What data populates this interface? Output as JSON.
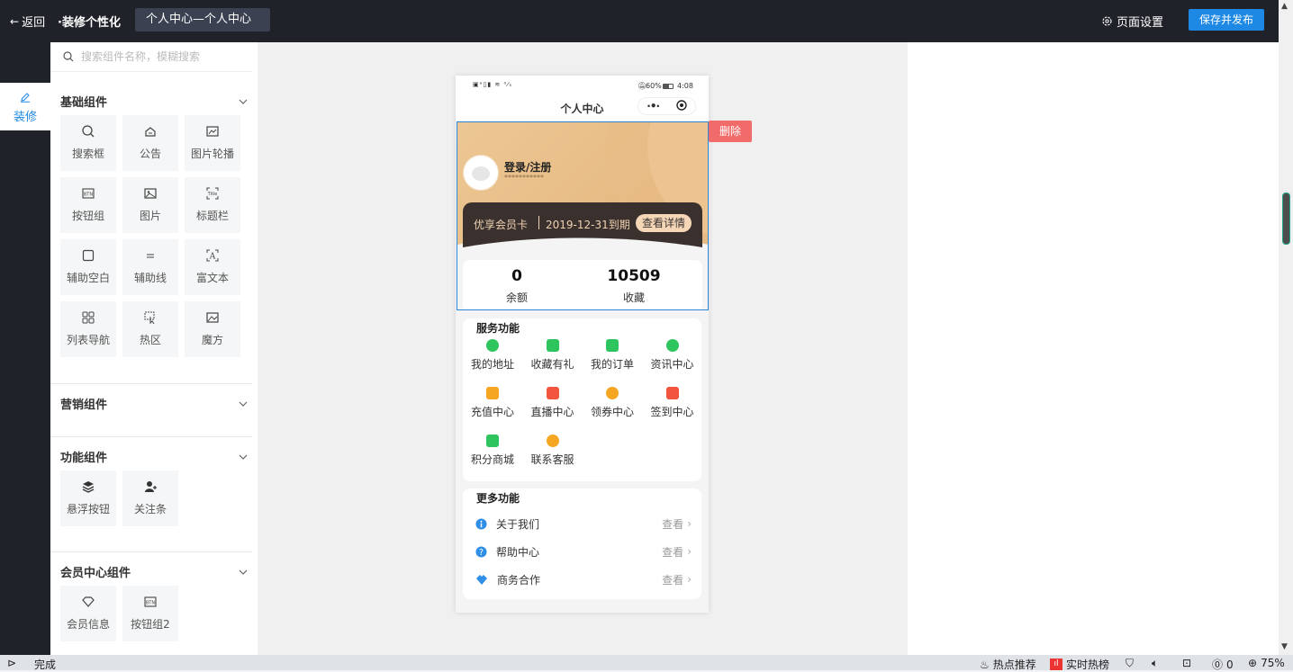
{
  "topbar": {
    "back": "返回",
    "title": "·装修个性化",
    "page_select": "个人中心—个人中心",
    "page_settings": "页面设置",
    "publish": "保存并发布"
  },
  "leftrail": {
    "tab": "装修"
  },
  "panel": {
    "search_placeholder": "搜索组件名称，模糊搜索",
    "sections": {
      "basic": "基础组件",
      "marketing": "营销组件",
      "function": "功能组件",
      "member": "会员中心组件"
    },
    "basic_items": [
      "搜索框",
      "公告",
      "图片轮播",
      "按钮组",
      "图片",
      "标题栏",
      "辅助空白",
      "辅助线",
      "富文本",
      "列表导航",
      "热区",
      "魔方"
    ],
    "function_items": [
      "悬浮按钮",
      "关注条"
    ],
    "member_items": [
      "会员信息",
      "按钮组2"
    ]
  },
  "phone": {
    "status": {
      "left": "▣ᵊ▯▮ ≋ ⁰⁄ₛ",
      "battery": "60%",
      "time": "4:08"
    },
    "nav_title": "个人中心",
    "login": "登录/注册",
    "login_sub": "***********",
    "vip": {
      "name": "优享会员卡",
      "expire": "2019-12-31到期",
      "detail": "查看详情"
    },
    "stats": [
      {
        "value": "0",
        "label": "余额"
      },
      {
        "value": "10509",
        "label": "收藏"
      }
    ],
    "services": {
      "title": "服务功能",
      "items": [
        {
          "label": "我的地址",
          "color": "#2ec45e"
        },
        {
          "label": "收藏有礼",
          "color": "#2ec45e"
        },
        {
          "label": "我的订单",
          "color": "#2ec45e"
        },
        {
          "label": "资讯中心",
          "color": "#2ec45e"
        },
        {
          "label": "充值中心",
          "color": "#f5a623"
        },
        {
          "label": "直播中心",
          "color": "#f2543d"
        },
        {
          "label": "领券中心",
          "color": "#f5a623"
        },
        {
          "label": "签到中心",
          "color": "#f2543d"
        },
        {
          "label": "积分商城",
          "color": "#2ec45e"
        },
        {
          "label": "联系客服",
          "color": "#f5a623"
        }
      ]
    },
    "more": {
      "title": "更多功能",
      "view": "查看",
      "items": [
        "关于我们",
        "帮助中心",
        "商务合作"
      ]
    },
    "delete": "删除"
  },
  "bottombar": {
    "status": "完成",
    "hot": "热点推荐",
    "trend": "实时热榜",
    "zero": "0",
    "zoom": "75%"
  }
}
